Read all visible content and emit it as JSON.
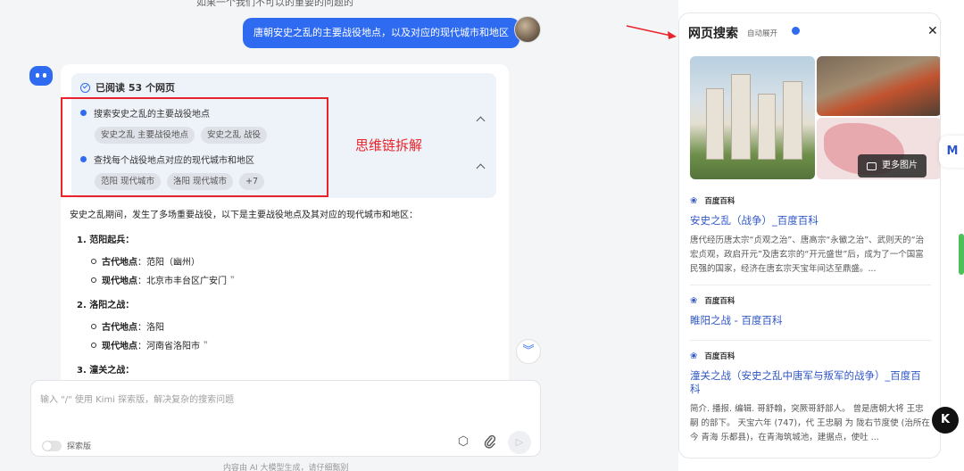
{
  "chat": {
    "user_message": "唐朝安史之乱的主要战役地点，以及对应的现代城市和地区",
    "top_cut_text": "如果一个我们不可以的重要的问题的",
    "reading": {
      "header": "已阅读 53 个网页",
      "steps": [
        {
          "label": "搜索安史之乱的主要战役地点",
          "tags": [
            "安史之乱 主要战役地点",
            "安史之乱 战役"
          ]
        },
        {
          "label": "查找每个战役地点对应的现代城市和地区",
          "tags": [
            "范阳 现代城市",
            "洛阳 现代城市",
            "+7"
          ]
        }
      ]
    },
    "annotation_label": "思维链拆解",
    "answer": {
      "intro": "安史之乱期间，发生了多场重要战役，以下是主要战役地点及其对应的现代城市和地区：",
      "items": [
        {
          "title": "1. 范阳起兵：",
          "ancient_label": "古代地点",
          "ancient": "：范阳（幽州）",
          "modern_label": "现代地点",
          "modern": "：北京市丰台区广安门"
        },
        {
          "title": "2. 洛阳之战：",
          "ancient_label": "古代地点",
          "ancient": "：洛阳",
          "modern_label": "现代地点",
          "modern": "：河南省洛阳市"
        },
        {
          "title": "3. 潼关之战："
        }
      ]
    },
    "input_placeholder": "输入 \"/\" 使用 Kimi 探索版，解决复杂的搜索问题",
    "mode_label": "探索版",
    "footnote": "内容由 AI 大模型生成，请仔细甄别"
  },
  "panel": {
    "title": "网页搜索",
    "auto_expand_label": "自动展开",
    "more_images_label": "更多图片",
    "results": [
      {
        "source": "百度百科",
        "title": "安史之乱（战争）_百度百科",
        "snippet": "唐代经历唐太宗“贞观之治”、唐高宗“永徽之治”、武则天的“治宏贞观，政启开元”及唐玄宗的“开元盛世”后，成为了一个国富民强的国家，经济在唐玄宗天宝年间达至鼎盛。..."
      },
      {
        "source": "百度百科",
        "title": "睢阳之战 - 百度百科",
        "snippet": ""
      },
      {
        "source": "百度百科",
        "title": "潼关之战（安史之乱中唐军与叛军的战争）_百度百科",
        "snippet": "简介. 播报. 编辑. 哥舒翰，突厥哥舒部人。 曾是唐朝大将 王忠嗣 的部下。 天宝六年 (747)，代 王忠嗣 为 陇右节度使 (治所在今 青海 乐都县)，在青海筑城池，建据点，使吐 ..."
      }
    ]
  },
  "icons": {
    "send": "send-icon",
    "attach": "paperclip-icon",
    "cube": "cube-icon",
    "close": "close-icon",
    "scroll": "double-chevron-down-icon"
  },
  "colors": {
    "accent": "#2f6bf1",
    "annotation": "#e8232b",
    "link": "#2f56c6"
  }
}
